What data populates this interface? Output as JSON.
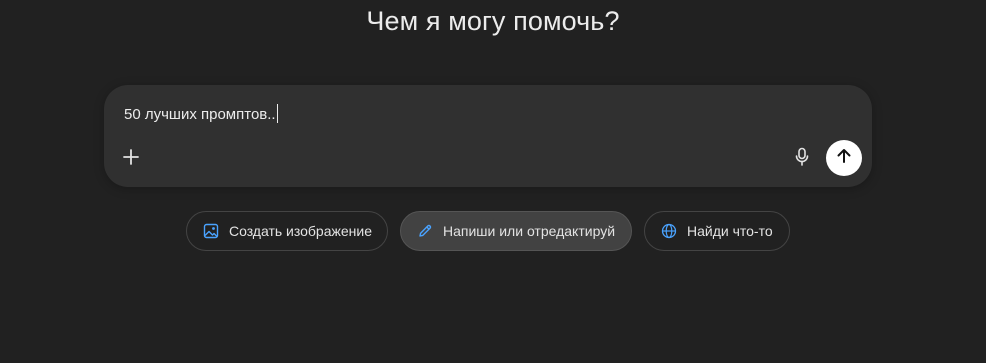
{
  "heading": "Чем я могу помочь?",
  "composer": {
    "input_value": "50 лучших промптов..",
    "plus_icon": "plus-icon",
    "mic_icon": "microphone-icon",
    "send_icon": "arrow-up-icon"
  },
  "suggestions": [
    {
      "label": "Создать изображение",
      "icon": "image-icon",
      "icon_color": "#4aa3ff",
      "active": false
    },
    {
      "label": "Напиши или отредактируй",
      "icon": "pen-icon",
      "icon_color": "#4aa3ff",
      "active": true
    },
    {
      "label": "Найди что-то",
      "icon": "globe-icon",
      "icon_color": "#4aa3ff",
      "active": false
    }
  ],
  "colors": {
    "background": "#212121",
    "composer": "#303030",
    "accent": "#4aa3ff",
    "send_button": "#ffffff"
  }
}
